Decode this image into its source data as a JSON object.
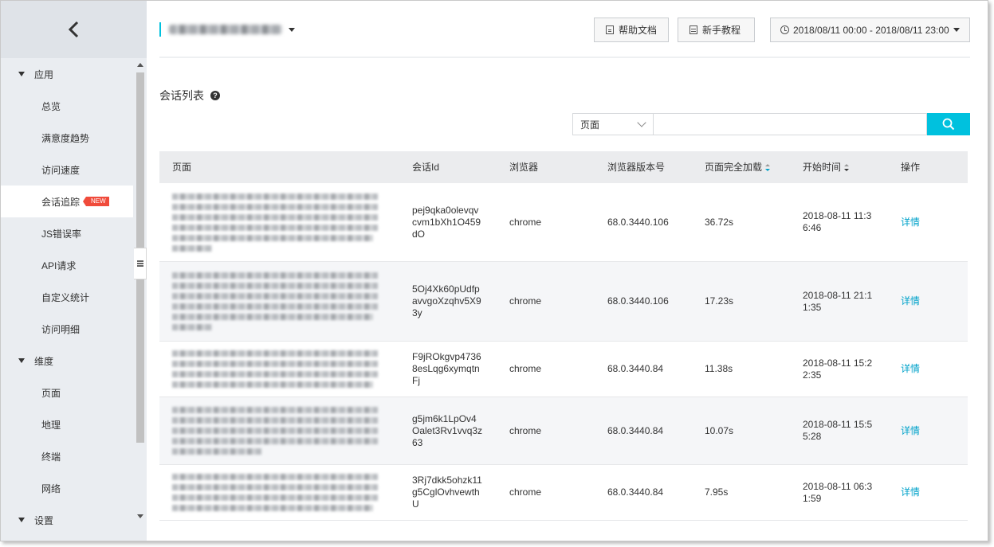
{
  "sidebar": {
    "groups": [
      {
        "label": "应用",
        "items": [
          "总览",
          "满意度趋势",
          "访问速度",
          "会话追踪",
          "JS错误率",
          "API请求",
          "自定义统计",
          "访问明细"
        ]
      },
      {
        "label": "维度",
        "items": [
          "页面",
          "地理",
          "终端",
          "网络"
        ]
      },
      {
        "label": "设置",
        "items": []
      }
    ],
    "active_item": "会话追踪",
    "new_badge": "NEW"
  },
  "header": {
    "help_doc": "帮助文档",
    "tutorial": "新手教程",
    "date_range": "2018/08/11 00:00 - 2018/08/11 23:00"
  },
  "section": {
    "title": "会话列表"
  },
  "search": {
    "scope": "页面",
    "placeholder": ""
  },
  "table": {
    "columns": [
      "页面",
      "会话Id",
      "浏览器",
      "浏览器版本号",
      "页面完全加载",
      "开始时间",
      "操作"
    ],
    "rows": [
      {
        "session_id": [
          "pej9qka0olevqv",
          "cvm1bXh1O459",
          "dO"
        ],
        "browser": "chrome",
        "version": "68.0.3440.106",
        "load": "36.72s",
        "start": [
          "2018-08-11 11:3",
          "6:46"
        ],
        "action": "详情",
        "height": 99,
        "blur": [
          92,
          92,
          92,
          92,
          90,
          18
        ]
      },
      {
        "session_id": [
          "5Oj4Xk60pUdfp",
          "avvgoXzqhv5X9",
          "3y"
        ],
        "browser": "chrome",
        "version": "68.0.3440.106",
        "load": "17.23s",
        "start": [
          "2018-08-11 21:1",
          "1:35"
        ],
        "action": "详情",
        "height": 100,
        "blur": [
          92,
          92,
          92,
          92,
          90,
          18
        ]
      },
      {
        "session_id": [
          "F9jROkgvp4736",
          "8esLqg6xymqtn",
          "Fj"
        ],
        "browser": "chrome",
        "version": "68.0.3440.84",
        "load": "11.38s",
        "start": [
          "2018-08-11 15:2",
          "2:35"
        ],
        "action": "详情",
        "height": 70,
        "blur": [
          92,
          92,
          92,
          90
        ]
      },
      {
        "session_id": [
          "g5jm6k1LpOv4",
          "Oalet3Rv1vvq3z",
          "63"
        ],
        "browser": "chrome",
        "version": "68.0.3440.84",
        "load": "10.07s",
        "start": [
          "2018-08-11 15:5",
          "5:28"
        ],
        "action": "详情",
        "height": 85,
        "blur": [
          92,
          92,
          92,
          92,
          40
        ]
      },
      {
        "session_id": [
          "3Rj7dkk5ohzk11",
          "g5CglOvhvewth",
          "U"
        ],
        "browser": "chrome",
        "version": "68.0.3440.84",
        "load": "7.95s",
        "start": [
          "2018-08-11 06:3",
          "1:59"
        ],
        "action": "详情",
        "height": 70,
        "blur": [
          92,
          92,
          92,
          90
        ]
      }
    ]
  }
}
